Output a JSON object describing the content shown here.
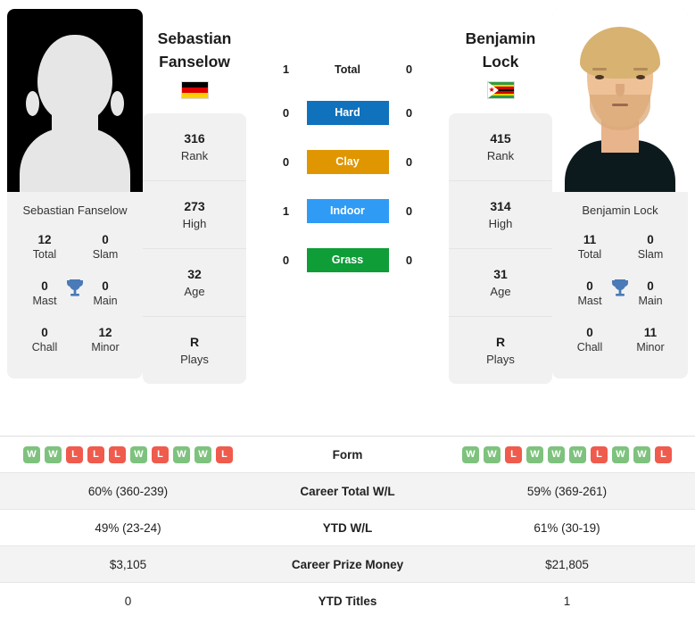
{
  "players": {
    "left": {
      "first_name": "Sebastian",
      "last_name": "Fanselow",
      "full_name": "Sebastian Fanselow",
      "photo_type": "placeholder-silhouette",
      "flag": "germany-flag",
      "flag_name": "Germany",
      "rank": "316",
      "rank_label": "Rank",
      "high": "273",
      "high_label": "High",
      "age": "32",
      "age_label": "Age",
      "plays": "R",
      "plays_label": "Plays",
      "titles": {
        "total": "12",
        "total_label": "Total",
        "slam": "0",
        "slam_label": "Slam",
        "mast": "0",
        "mast_label": "Mast",
        "main": "0",
        "main_label": "Main",
        "chall": "0",
        "chall_label": "Chall",
        "minor": "12",
        "minor_label": "Minor"
      },
      "form": [
        "W",
        "W",
        "L",
        "L",
        "L",
        "W",
        "L",
        "W",
        "W",
        "L"
      ],
      "career_total_wl": "60% (360-239)",
      "ytd_wl": "49% (23-24)",
      "career_prize_money": "$3,105",
      "ytd_titles": "0"
    },
    "right": {
      "first_name": "Benjamin",
      "last_name": "Lock",
      "full_name": "Benjamin Lock",
      "photo_type": "portrait-photo",
      "flag": "zimbabwe-flag",
      "flag_name": "Zimbabwe",
      "rank": "415",
      "rank_label": "Rank",
      "high": "314",
      "high_label": "High",
      "age": "31",
      "age_label": "Age",
      "plays": "R",
      "plays_label": "Plays",
      "titles": {
        "total": "11",
        "total_label": "Total",
        "slam": "0",
        "slam_label": "Slam",
        "mast": "0",
        "mast_label": "Mast",
        "main": "0",
        "main_label": "Main",
        "chall": "0",
        "chall_label": "Chall",
        "minor": "11",
        "minor_label": "Minor"
      },
      "form": [
        "W",
        "W",
        "L",
        "W",
        "W",
        "W",
        "L",
        "W",
        "W",
        "L"
      ],
      "career_total_wl": "59% (369-261)",
      "ytd_wl": "61% (30-19)",
      "career_prize_money": "$21,805",
      "ytd_titles": "1"
    }
  },
  "head_to_head": {
    "total": {
      "label": "Total",
      "left": "1",
      "right": "0"
    },
    "surfaces": [
      {
        "label": "Hard",
        "left": "0",
        "right": "0",
        "color": "#1071bd"
      },
      {
        "label": "Clay",
        "left": "0",
        "right": "0",
        "color": "#e09600"
      },
      {
        "label": "Indoor",
        "left": "1",
        "right": "0",
        "color": "#2f9bf5"
      },
      {
        "label": "Grass",
        "left": "0",
        "right": "0",
        "color": "#0f9d38"
      }
    ]
  },
  "stats_table": {
    "rows": [
      {
        "label": "Form",
        "type": "form"
      },
      {
        "label": "Career Total W/L",
        "type": "text",
        "key": "career_total_wl"
      },
      {
        "label": "YTD W/L",
        "type": "text",
        "key": "ytd_wl"
      },
      {
        "label": "Career Prize Money",
        "type": "text",
        "key": "career_prize_money"
      },
      {
        "label": "YTD Titles",
        "type": "text",
        "key": "ytd_titles"
      }
    ]
  },
  "colors": {
    "win_badge": "#7ec27e",
    "loss_badge": "#ef5b4c",
    "trophy": "#4a7ab8",
    "panel": "#f1f1f1",
    "row_alt": "#f3f3f3"
  }
}
